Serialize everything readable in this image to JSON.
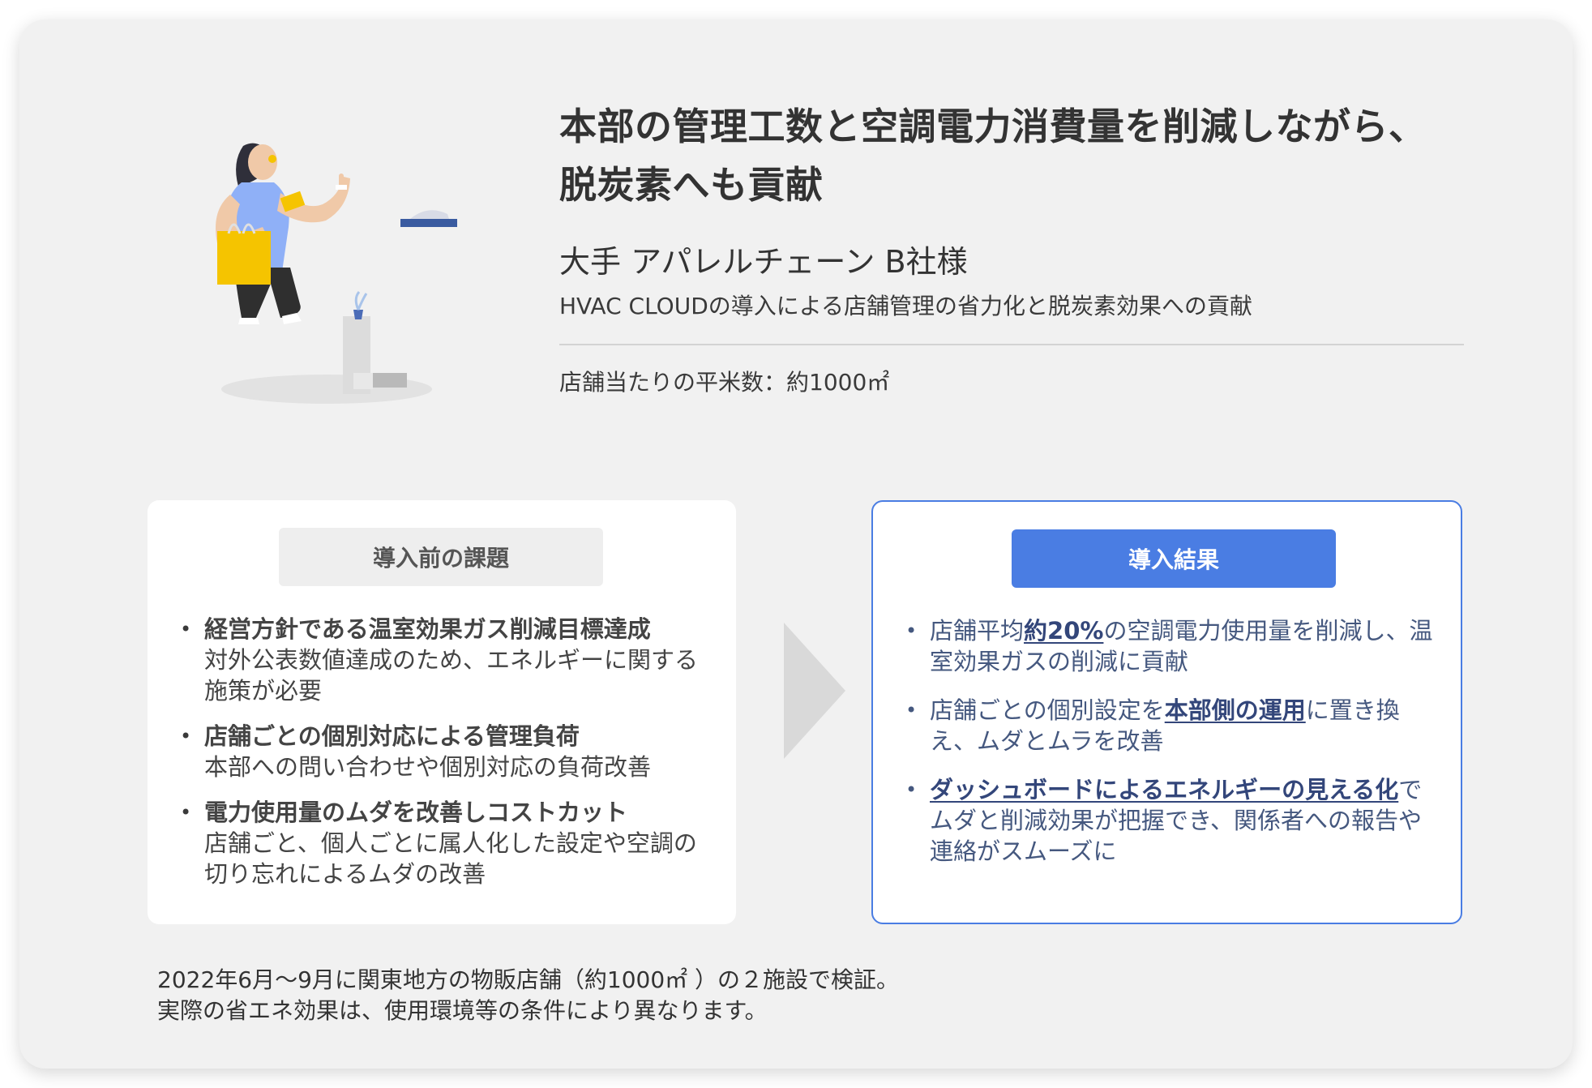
{
  "header": {
    "title_line1": "本部の管理工数と空調電力消費量を削減しながら、",
    "title_line2": "脱炭素へも貢献",
    "client": "大手 アパレルチェーン B社様",
    "subtitle": "HVAC CLOUDの導入による店舗管理の省力化と脱炭素効果への貢献",
    "area": "店舗当たりの平米数：約1000㎡"
  },
  "before": {
    "heading": "導入前の課題",
    "items": [
      {
        "title": "経営方針である温室効果ガス削減目標達成",
        "desc": "対外公表数値達成のため、エネルギーに関する施策が必要"
      },
      {
        "title": "店舗ごとの個別対応による管理負荷",
        "desc": "本部への問い合わせや個別対応の負荷改善"
      },
      {
        "title": "電力使用量のムダを改善しコストカット",
        "desc": "店舗ごと、個人ごとに属人化した設定や空調の切り忘れによるムダの改善"
      }
    ]
  },
  "after": {
    "heading": "導入結果",
    "items": [
      {
        "pre": "店舗平均",
        "hl": "約20%",
        "post": "の空調電力使用量を削減し、温室効果ガスの削減に貢献"
      },
      {
        "pre": "店舗ごとの個別設定を",
        "hl": "本部側の運用",
        "post": "に置き換え、ムダとムラを改善"
      },
      {
        "pre": "",
        "hl": "ダッシュボードによるエネルギーの見える化",
        "post": "でムダと削減効果が把握でき、関係者への報告や連絡がスムーズに"
      }
    ]
  },
  "footnote": {
    "line1": "2022年6月～9月に関東地方の物販店舗（約1000㎡ ）の２施設で検証。",
    "line2": "実際の省エネ効果は、使用環境等の条件により異なります。"
  },
  "colors": {
    "accent": "#4a7de3",
    "result_text": "#45587f",
    "card_bg": "#f1f1f1"
  }
}
